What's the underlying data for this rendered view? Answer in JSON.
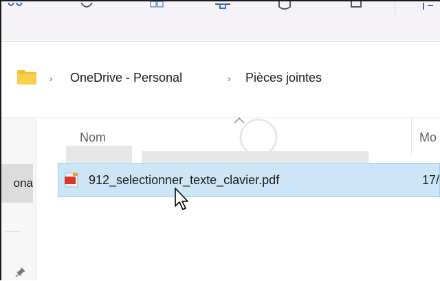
{
  "toolbar": {
    "icons": [
      "view-icon",
      "undo-icon",
      "copy-icon",
      "share-icon",
      "rename-icon",
      "delete-icon",
      "more-icon"
    ]
  },
  "address_bar": {
    "folder_icon": "folder-icon",
    "separator": "›",
    "breadcrumbs": [
      {
        "label": "OneDrive - Personal"
      },
      {
        "label": "Pièces jointes"
      }
    ]
  },
  "navigation": {
    "selected_item_label": "ona",
    "pin_icon": "pin-icon"
  },
  "file_list": {
    "columns": [
      {
        "label": "Nom"
      },
      {
        "label": "Mo"
      }
    ],
    "sort_indicator": "sort-ascending-caret",
    "rows": [
      {
        "icon": "pdf-file-icon",
        "name": "912_selectionner_texte_clavier.pdf",
        "date": "17/"
      }
    ]
  },
  "colors": {
    "selection_fill": "#cde6f7",
    "selection_border": "#99d1f5",
    "folder": "#f2c12e",
    "pdf_red": "#d9352a"
  }
}
